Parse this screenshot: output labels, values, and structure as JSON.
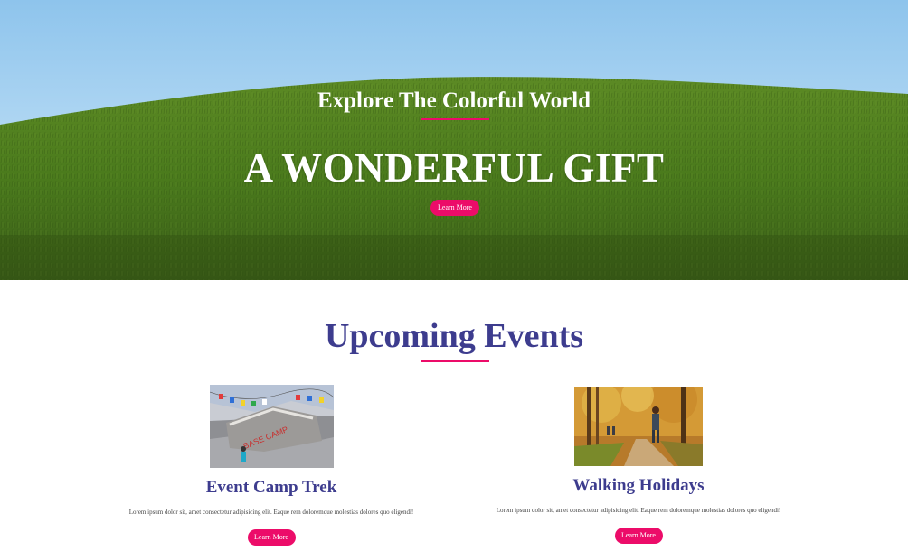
{
  "hero": {
    "subtitle": "Explore The Colorful World",
    "title": "A WONDERFUL GIFT",
    "button_label": "Learn More",
    "image": "rolling-green-hill-under-blue-sky"
  },
  "events": {
    "section_title": "Upcoming Events",
    "items": [
      {
        "title": "Event Camp Trek",
        "description": "Lorem ipsum dolor sit, amet consectetur adipisicing elit. Eaque rem doloremque molestias dolores quo eligendi!",
        "button_label": "Learn More",
        "image": "base-camp-rock-with-prayer-flags"
      },
      {
        "title": "Walking Holidays",
        "description": "Lorem ipsum dolor sit, amet consectetur adipisicing elit. Eaque rem doloremque molestias dolores quo eligendi!",
        "button_label": "Learn More",
        "image": "hikers-on-autumn-forest-path"
      }
    ]
  },
  "colors": {
    "accent": "#ec0c69",
    "heading": "#3d3c8e",
    "sky": "#9fd0f2",
    "grass": "#4d7c1e"
  }
}
